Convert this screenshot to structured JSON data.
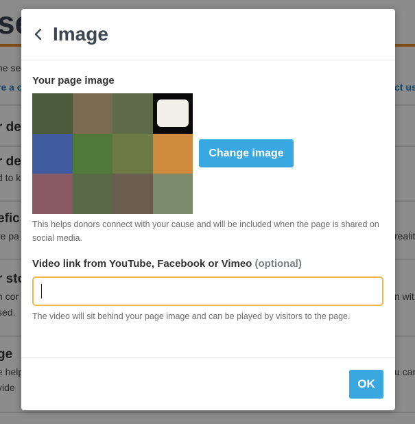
{
  "background": {
    "title_fragment": "se",
    "lines": [
      "ne se",
      "re a c",
      "ct us",
      "r det",
      "d to k",
      "efic",
      "re pa",
      "realit",
      "r sto",
      "n cor",
      "n wit",
      "sed.",
      "ge",
      "e help",
      "u car",
      "vide"
    ]
  },
  "modal": {
    "title": "Image",
    "page_image_label": "Your page image",
    "change_image_label": "Change image",
    "image_help": "This helps donors connect with your cause and will be included when the page is shared on social media.",
    "video_label": "Video link from YouTube, Facebook or Vimeo",
    "video_optional": "(optional)",
    "video_value": "",
    "video_placeholder": "",
    "video_help": "The video will sit behind your page image and can be played by visitors to the page.",
    "ok_label": "OK"
  },
  "colors": {
    "accent": "#3aa8e0",
    "input_focus": "#f0b64a",
    "header_stripe": "#e8891e"
  },
  "photo_tiles": [
    "#4b5a3a",
    "#7b6a52",
    "#5d6b4a",
    "#0a0a0a",
    "#3f5a9e",
    "#4f7a3c",
    "#6e7a45",
    "#d08a3e",
    "#8a5a62",
    "#5a6a48",
    "#6b5d4e",
    "#7c8a6e"
  ]
}
